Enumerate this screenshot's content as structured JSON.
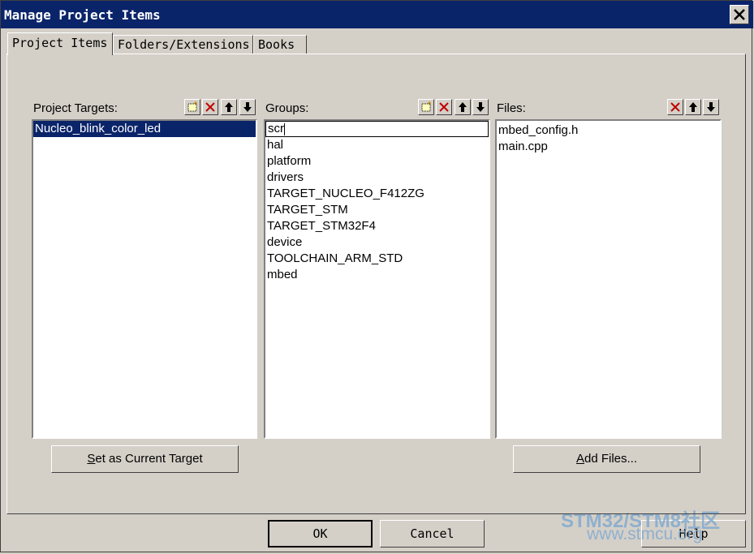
{
  "window": {
    "title": "Manage Project Items"
  },
  "tabs": [
    {
      "label": "Project Items"
    },
    {
      "label": "Folders/Extensions"
    },
    {
      "label": "Books"
    }
  ],
  "targets": {
    "header": "Project Targets:",
    "items": [
      "Nucleo_blink_color_led"
    ],
    "selected": "Nucleo_blink_color_led",
    "button_prefix": "S",
    "button_rest": "et as Current Target"
  },
  "groups": {
    "header": "Groups:",
    "editing_value": "scr",
    "items": [
      "hal",
      "platform",
      "drivers",
      "TARGET_NUCLEO_F412ZG",
      "TARGET_STM",
      "TARGET_STM32F4",
      "device",
      "TOOLCHAIN_ARM_STD",
      "mbed"
    ]
  },
  "files": {
    "header": "Files:",
    "items": [
      "mbed_config.h",
      "main.cpp"
    ],
    "button_prefix": "A",
    "button_rest": "dd Files..."
  },
  "footer": {
    "ok_label": "OK",
    "cancel_label": "Cancel",
    "help_label": "Help"
  },
  "watermark": {
    "line1": "STM32/STM8社区",
    "line2": "www.stmcu.org"
  }
}
